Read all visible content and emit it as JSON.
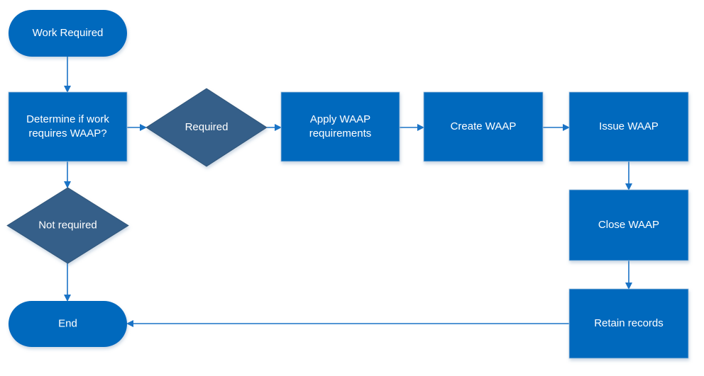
{
  "diagram": {
    "type": "flowchart",
    "colors": {
      "process": "#0069bd",
      "decision": "#355f89",
      "terminator": "#0069bd",
      "connector": "#1a73c6",
      "text": "#ffffff"
    },
    "nodes": [
      {
        "id": "work-required",
        "shape": "terminator",
        "lines": [
          "Work Required"
        ]
      },
      {
        "id": "determine",
        "shape": "process",
        "lines": [
          "Determine if work",
          "requires WAAP?"
        ]
      },
      {
        "id": "required",
        "shape": "decision",
        "lines": [
          "Required"
        ]
      },
      {
        "id": "apply",
        "shape": "process",
        "lines": [
          "Apply WAAP",
          "requirements"
        ]
      },
      {
        "id": "create",
        "shape": "process",
        "lines": [
          "Create WAAP"
        ]
      },
      {
        "id": "issue",
        "shape": "process",
        "lines": [
          "Issue WAAP"
        ]
      },
      {
        "id": "not-required",
        "shape": "decision",
        "lines": [
          "Not required"
        ]
      },
      {
        "id": "end",
        "shape": "terminator",
        "lines": [
          "End"
        ]
      },
      {
        "id": "close",
        "shape": "process",
        "lines": [
          "Close WAAP"
        ]
      },
      {
        "id": "retain",
        "shape": "process",
        "lines": [
          "Retain records"
        ]
      }
    ],
    "edges": [
      {
        "from": "work-required",
        "to": "determine"
      },
      {
        "from": "determine",
        "to": "required"
      },
      {
        "from": "required",
        "to": "apply"
      },
      {
        "from": "apply",
        "to": "create"
      },
      {
        "from": "create",
        "to": "issue"
      },
      {
        "from": "issue",
        "to": "close"
      },
      {
        "from": "close",
        "to": "retain"
      },
      {
        "from": "retain",
        "to": "end"
      },
      {
        "from": "determine",
        "to": "not-required"
      },
      {
        "from": "not-required",
        "to": "end"
      }
    ]
  }
}
